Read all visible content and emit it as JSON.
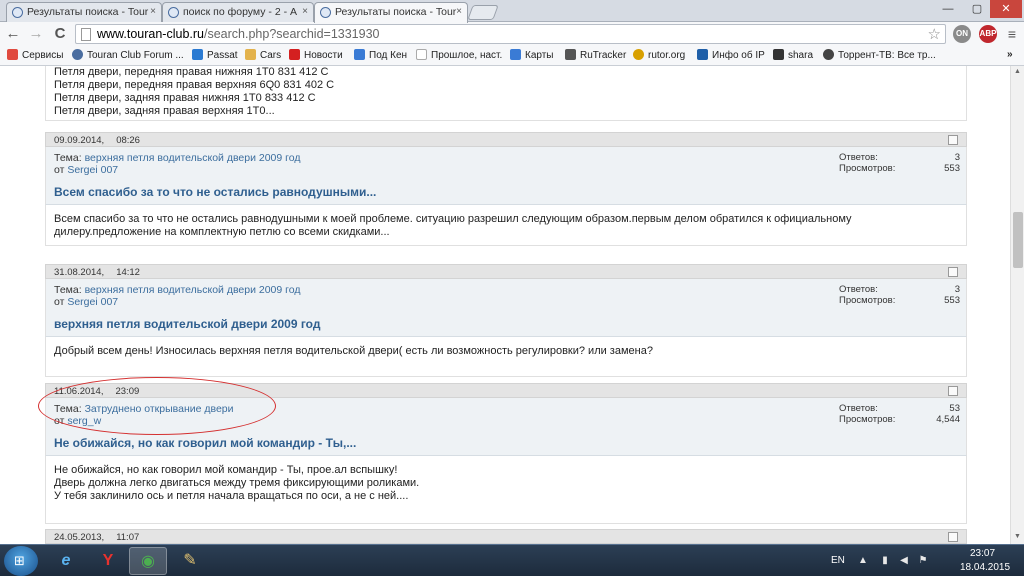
{
  "browser": {
    "tabs": [
      {
        "title": "Результаты поиска - Tour",
        "active": false
      },
      {
        "title": "поиск по форуму - 2 - А",
        "active": false
      },
      {
        "title": "Результаты поиска - Tour",
        "active": true
      }
    ],
    "close_glyph": "×",
    "window_controls": {
      "minimize": "—",
      "maximize": "▢",
      "close": "✕"
    },
    "url_host": "www.touran-club.ru",
    "url_path": "/search.php?searchid=1331930",
    "nav": {
      "back": "←",
      "forward": "→",
      "reload": "C",
      "star": "☆",
      "menu": "≡"
    },
    "extensions": [
      {
        "label": "ON",
        "color": "#8a8a8a"
      },
      {
        "label": "ABP",
        "color": "#c0272d"
      }
    ],
    "bookmarks": [
      {
        "label": "Сервисы",
        "icon_color": "#e04a3f"
      },
      {
        "label": "Touran Club Forum ...",
        "icon_color": "#4a6da0"
      },
      {
        "label": "Passat",
        "icon_color": "#2a7ad2"
      },
      {
        "label": "Cars",
        "icon_color": "#e3b24c"
      },
      {
        "label": "Новости",
        "icon_color": "#d42020"
      },
      {
        "label": "Под Кен",
        "icon_color": "#3a7bd5"
      },
      {
        "label": "Прошлое, наст.",
        "icon_color": "#aaaaaa"
      },
      {
        "label": "Карты",
        "icon_color": "#3a7bd5"
      },
      {
        "label": "RuTracker",
        "icon_color": "#555555"
      },
      {
        "label": "rutor.org",
        "icon_color": "#d8a000"
      },
      {
        "label": "Инфо об IP",
        "icon_color": "#1f5fa8"
      },
      {
        "label": "shara",
        "icon_color": "#333333"
      },
      {
        "label": "Торрент-ТВ: Все тр...",
        "icon_color": "#444444"
      }
    ],
    "bookmarks_more": "»"
  },
  "prev_post_lines": [
    "Петля двери, передняя правая нижняя 1T0 831 412 C",
    "Петля двери, передняя правая верхняя 6Q0 831 402 C",
    "Петля двери, задняя правая нижняя 1T0 833 412 C",
    "Петля двери, задняя правая верхняя 1T0..."
  ],
  "posts": [
    {
      "date": "09.09.2014,",
      "time": "08:26",
      "topic_label": "Тема:",
      "topic": "верхняя петля водительской двери 2009 год",
      "by_label": "от",
      "author": "Sergei 007",
      "replies_label": "Ответов:",
      "replies": "3",
      "views_label": "Просмотров:",
      "views": "553",
      "title": "Всем спасибо за то что не остались равнодушными...",
      "lines": [
        "Всем спасибо за то что не остались равнодушными к моей проблеме. ситуацию разрешил следующим образом.первым делом обратился к официальному",
        "дилеру.предложение на комплектную петлю со всеми скидками..."
      ]
    },
    {
      "date": "31.08.2014,",
      "time": "14:12",
      "topic_label": "Тема:",
      "topic": "верхняя петля водительской двери 2009 год",
      "by_label": "от",
      "author": "Sergei 007",
      "replies_label": "Ответов:",
      "replies": "3",
      "views_label": "Просмотров:",
      "views": "553",
      "title": "верхняя петля водительской двери 2009 год",
      "lines": [
        "Добрый всем день! Износилась верхняя петля водительской двери( есть ли возможность регулировки? или замена?"
      ]
    },
    {
      "date": "11.06.2014,",
      "time": "23:09",
      "topic_label": "Тема:",
      "topic": "Затруднено открывание двери",
      "by_label": "от",
      "author": "serg_w",
      "replies_label": "Ответов:",
      "replies": "53",
      "views_label": "Просмотров:",
      "views": "4,544",
      "title": "Не обижайся, но как говорил мой командир - Ты,...",
      "lines": [
        "Не обижайся, но как говорил мой командир - Ты, прое.ал вспышку!",
        "Дверь должна легко двигаться между тремя фиксирующими роликами.",
        "У тебя заклинило ось и петля начала вращаться по оси, а не с ней...."
      ]
    },
    {
      "date": "24.05.2013,",
      "time": "11:07"
    }
  ],
  "taskbar": {
    "start_glyph": "⊞",
    "apps": [
      {
        "name": "internet-explorer",
        "glyph": "e",
        "color": "#5ab3f0"
      },
      {
        "name": "yandex-browser",
        "glyph": "Y",
        "color": "#e8322e"
      },
      {
        "name": "chrome",
        "glyph": "◉",
        "color": "#4caf50"
      },
      {
        "name": "paint",
        "glyph": "✎",
        "color": "#e0c070"
      }
    ],
    "lang": "EN",
    "time": "23:07",
    "date": "18.04.2015",
    "tray_glyphs": [
      "▲",
      "▮",
      "◀",
      "⚑"
    ]
  }
}
